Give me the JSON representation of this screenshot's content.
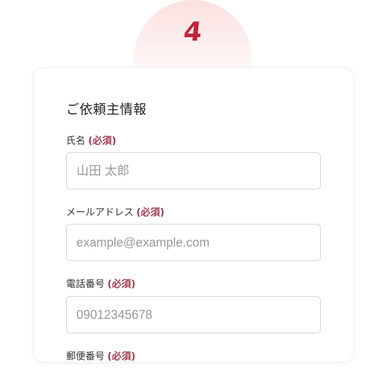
{
  "step": {
    "number": "4"
  },
  "form": {
    "section_title": "ご依頼主情報",
    "required_label": "(必須)",
    "fields": [
      {
        "label": "氏名",
        "placeholder": "山田 太郎"
      },
      {
        "label": "メールアドレス",
        "placeholder": "example@example.com"
      },
      {
        "label": "電話番号",
        "placeholder": "09012345678"
      },
      {
        "label": "郵便番号"
      }
    ]
  },
  "colors": {
    "accent": "#c0243b",
    "required": "#a43c4e",
    "badge_bg": "#fbe1e1"
  }
}
